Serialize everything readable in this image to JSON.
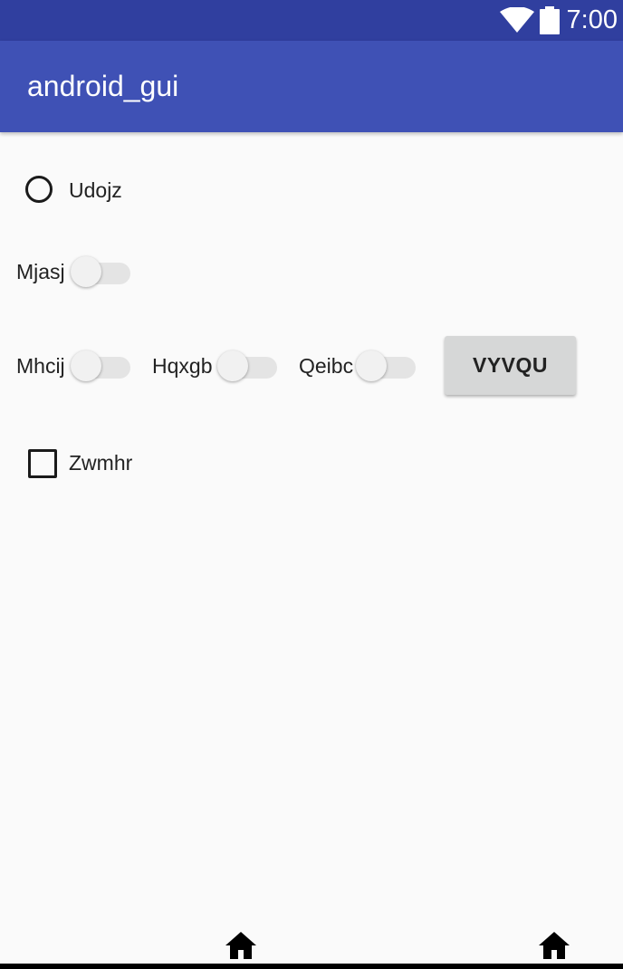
{
  "status_bar": {
    "time": "7:00",
    "icons": [
      "wifi-icon",
      "battery-icon"
    ]
  },
  "app_bar": {
    "title": "android_gui"
  },
  "content": {
    "radio": {
      "label": "Udojz",
      "checked": false
    },
    "switch_mjasj": {
      "label": "Mjasj",
      "on": false
    },
    "switch_mhcij": {
      "label": "Mhcij",
      "on": false
    },
    "switch_hqxgb": {
      "label": "Hqxgb",
      "on": false
    },
    "switch_qeibc": {
      "label": "Qeibc",
      "on": false
    },
    "button": {
      "label": "VYVQU"
    },
    "checkbox": {
      "label": "Zwmhr",
      "checked": false
    }
  },
  "nav_bar": {
    "icons": [
      "home-icon",
      "home-icon"
    ]
  },
  "colors": {
    "status_bar": "#303f9f",
    "app_bar": "#3f51b5",
    "background": "#fafafa",
    "button": "#d6d7d7"
  }
}
